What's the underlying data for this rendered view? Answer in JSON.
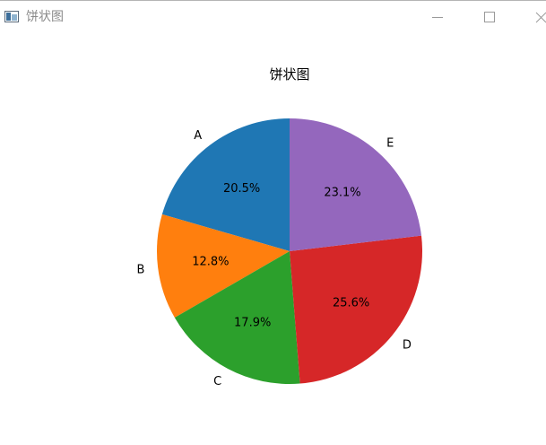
{
  "window": {
    "title": "饼状图",
    "app_icon": "matplotlib-figure-icon",
    "controls": [
      "minimize-icon",
      "maximize-icon",
      "close-icon"
    ]
  },
  "colors": {
    "A": "#1f77b4",
    "B": "#ff7f0e",
    "C": "#2ca02c",
    "D": "#d62728",
    "E": "#9467bd"
  },
  "chart_data": {
    "type": "pie",
    "title": "饼状图",
    "categories": [
      "A",
      "B",
      "C",
      "D",
      "E"
    ],
    "values": [
      20.5,
      12.8,
      17.9,
      25.6,
      23.1
    ],
    "labels": [
      "20.5%",
      "12.8%",
      "17.9%",
      "25.6%",
      "23.1%"
    ],
    "start_angle_deg": 90,
    "direction": "counterclockwise",
    "legend": "none"
  }
}
